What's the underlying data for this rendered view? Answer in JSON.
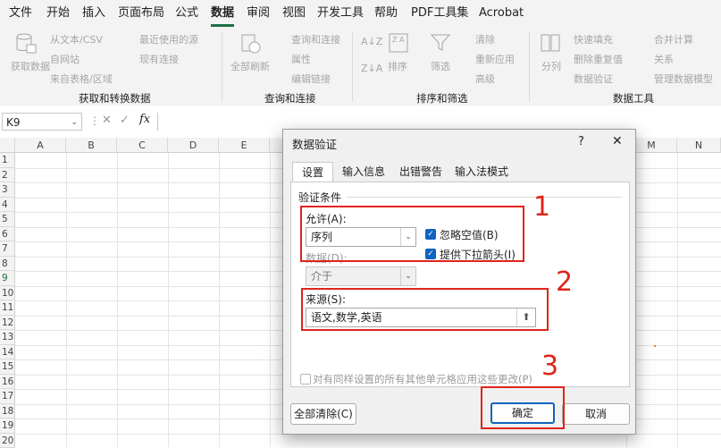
{
  "menu": {
    "items": [
      "文件",
      "开始",
      "插入",
      "页面布局",
      "公式",
      "数据",
      "审阅",
      "视图",
      "开发工具",
      "帮助",
      "PDF工具集",
      "Acrobat"
    ],
    "active": "数据"
  },
  "ribbon": {
    "get_transform": {
      "big_button": "获取数据",
      "items": [
        "从文本/CSV",
        "自网站",
        "来自表格/区域",
        "最近使用的源",
        "现有连接"
      ],
      "label": "获取和转换数据"
    },
    "query_connections": {
      "big_button": "全部刷新",
      "items": [
        "查询和连接",
        "属性",
        "编辑链接"
      ],
      "label": "查询和连接"
    },
    "sort_filter": {
      "items": [
        "排序",
        "筛选",
        "清除",
        "重新应用",
        "高级"
      ],
      "label": "排序和筛选"
    },
    "data_tools": {
      "items": [
        "分列",
        "快速填充",
        "删除重复值",
        "数据验证",
        "合并计算",
        "关系",
        "管理数据模型"
      ],
      "label": "数据工具"
    }
  },
  "formula_bar": {
    "name_box": "K9",
    "fx": "fx"
  },
  "grid": {
    "columns": [
      "A",
      "B",
      "C",
      "D",
      "E",
      "",
      "",
      "",
      "",
      "",
      "",
      "M",
      "N"
    ],
    "rows": [
      "1",
      "2",
      "3",
      "4",
      "5",
      "6",
      "7",
      "8",
      "9",
      "10",
      "11",
      "12",
      "13",
      "14",
      "15",
      "16",
      "17",
      "18",
      "19",
      "20"
    ]
  },
  "dialog": {
    "title": "数据验证",
    "help": "?",
    "close": "✕",
    "tabs": [
      "设置",
      "输入信息",
      "出错警告",
      "输入法模式"
    ],
    "section_label": "验证条件",
    "allow_label": "允许(A):",
    "allow_value": "序列",
    "data_label": "数据(D):",
    "data_value": "介于",
    "ignore_blank_label": "忽略空值(B)",
    "in_cell_dropdown_label": "提供下拉箭头(I)",
    "source_label": "来源(S):",
    "source_value": "语文,数学,英语",
    "apply_all_label": "对有同样设置的所有其他单元格应用这些更改(P)",
    "clear_all_button": "全部清除(C)",
    "ok_button": "确定",
    "cancel_button": "取消"
  },
  "annotations": {
    "numbers": [
      "1",
      "2",
      "3"
    ],
    "color": "#e0241b"
  },
  "colors": {
    "accent": "#1d6f42",
    "checkbox": "#0f64c0"
  }
}
